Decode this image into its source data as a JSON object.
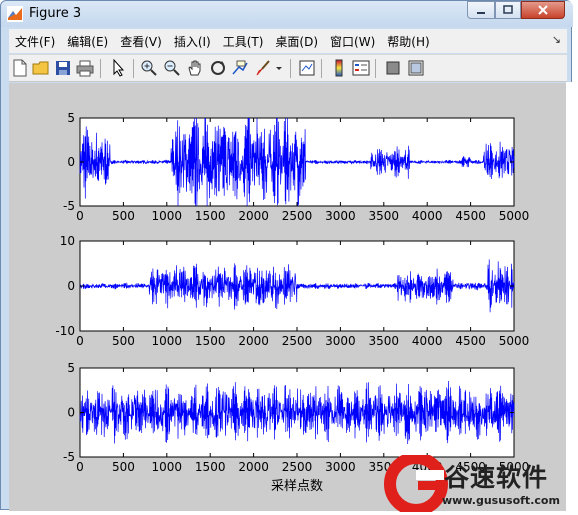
{
  "window": {
    "title": "Figure 3"
  },
  "menu": {
    "items": [
      "文件(F)",
      "编辑(E)",
      "查看(V)",
      "插入(I)",
      "工具(T)",
      "桌面(D)",
      "窗口(W)",
      "帮助(H)"
    ]
  },
  "toolbar": {
    "icons": [
      "new-figure-icon",
      "open-file-icon",
      "save-icon",
      "print-icon",
      "pointer-icon",
      "zoom-in-icon",
      "zoom-out-icon",
      "pan-icon",
      "rotate-3d-icon",
      "data-cursor-icon",
      "brush-icon",
      "dropdown-icon",
      "link-plot-icon",
      "colorbar-icon",
      "legend-icon",
      "hide-plot-tools-icon",
      "show-plot-tools-icon"
    ]
  },
  "chart_data": [
    {
      "type": "line",
      "series_color": "#0000ff",
      "xlim": [
        0,
        5000
      ],
      "ylim": [
        -5,
        5
      ],
      "xticks": [
        "0",
        "500",
        "1000",
        "1500",
        "2000",
        "2500",
        "3000",
        "3500",
        "4000",
        "4500",
        "5000"
      ],
      "yticks": [
        "5",
        "0",
        "-5"
      ],
      "segments": [
        {
          "x": [
            0,
            350
          ],
          "amplitude": 3.5
        },
        {
          "x": [
            350,
            1050
          ],
          "amplitude": 0.2
        },
        {
          "x": [
            1050,
            2600
          ],
          "amplitude": 4.8
        },
        {
          "x": [
            2600,
            3350
          ],
          "amplitude": 0.2
        },
        {
          "x": [
            3350,
            3800
          ],
          "amplitude": 1.5
        },
        {
          "x": [
            3800,
            4400
          ],
          "amplitude": 0.2
        },
        {
          "x": [
            4400,
            4500
          ],
          "amplitude": 1.0
        },
        {
          "x": [
            4500,
            4650
          ],
          "amplitude": 0.2
        },
        {
          "x": [
            4650,
            5000
          ],
          "amplitude": 2.0
        }
      ]
    },
    {
      "type": "line",
      "series_color": "#0000ff",
      "xlim": [
        0,
        5000
      ],
      "ylim": [
        -10,
        10
      ],
      "xticks": [
        "0",
        "500",
        "1000",
        "1500",
        "2000",
        "2500",
        "3000",
        "3500",
        "4000",
        "4500",
        "5000"
      ],
      "yticks": [
        "10",
        "0",
        "-10"
      ],
      "segments": [
        {
          "x": [
            0,
            800
          ],
          "amplitude": 0.6
        },
        {
          "x": [
            800,
            2500
          ],
          "amplitude": 4.5
        },
        {
          "x": [
            2500,
            3650
          ],
          "amplitude": 0.6
        },
        {
          "x": [
            3650,
            4300
          ],
          "amplitude": 3.5
        },
        {
          "x": [
            4300,
            4700
          ],
          "amplitude": 0.8
        },
        {
          "x": [
            4700,
            5000
          ],
          "amplitude": 5.5
        }
      ]
    },
    {
      "type": "line",
      "series_color": "#0000ff",
      "xlim": [
        0,
        5000
      ],
      "ylim": [
        -5,
        5
      ],
      "xticks": [
        "0",
        "500",
        "1000",
        "1500",
        "2000",
        "2500",
        "3000",
        "3500",
        "4000",
        "4500",
        "5000"
      ],
      "yticks": [
        "5",
        "0",
        "-5"
      ],
      "xlabel": "采样点数",
      "segments": [
        {
          "x": [
            0,
            5000
          ],
          "amplitude": 2.8
        }
      ]
    }
  ],
  "watermark": {
    "text": "谷速软件",
    "url": "www.gususoft.com"
  }
}
